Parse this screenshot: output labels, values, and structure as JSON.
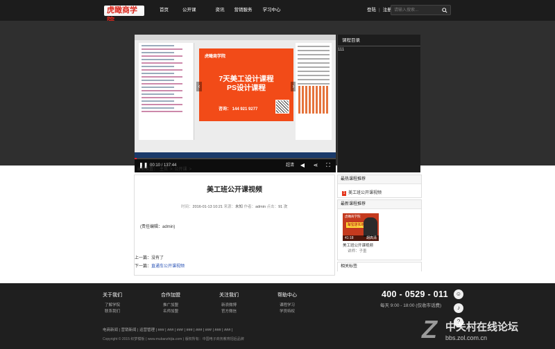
{
  "header": {
    "logo": "虎瞰商学院",
    "nav": [
      "首页",
      "公开课",
      "资讯",
      "营销服务",
      "学习中心"
    ],
    "login": "登陆",
    "register": "注册",
    "search_placeholder": "请输入搜索..."
  },
  "player": {
    "slide_logo": "虎瞰商学院",
    "slide_title1": "7天美工设计课程",
    "slide_title2": "PS设计课程",
    "slide_phone": "咨询：  144 921 9277",
    "time": "00:10 / 137:44",
    "quality": "超清",
    "progress": 0.01
  },
  "catalog": {
    "title": "课程目录",
    "item": "111"
  },
  "breadcrumb": {
    "label": "当前位置：",
    "home": "主页",
    "section": "公开课"
  },
  "article": {
    "title": "美工班公开课视频",
    "time_label": "时间：",
    "time": "2016-01-13 10:21",
    "source_label": "来源：",
    "source": "未知",
    "author_label": "作者：",
    "author": "admin",
    "clicks_label": "点击：",
    "clicks": "91 次",
    "editor": "(责任编辑：admin)",
    "prev": "上一篇：没有了",
    "next_label": "下一篇：",
    "next": "直通车公开课视频"
  },
  "sidebar": {
    "hot_title": "最热课程推荐",
    "hot_num": "1",
    "hot_item": "美工班公开课视频",
    "new_title": "最新课程推荐",
    "thumb_brand": "虎瞰商学院",
    "thumb_sign": "淘宝店长培训",
    "thumb_duration": "41:18",
    "thumb_name": "胡高清",
    "video_name": "美工班公开课视频",
    "lecturer": "讲师：子墨",
    "tags_title": "相关标签"
  },
  "footer": {
    "cols": [
      {
        "title": "关于我们",
        "links": [
          "了解学院",
          "联系我们"
        ]
      },
      {
        "title": "合作加盟",
        "links": [
          "推广加盟",
          "名师加盟"
        ]
      },
      {
        "title": "关注我们",
        "links": [
          "新浪微博",
          "官方微信"
        ]
      },
      {
        "title": "帮助中心",
        "links": [
          "课程学习",
          "学员特权"
        ]
      }
    ],
    "hotline": "400 - 0529 - 011",
    "hours": "每天 9:00 - 18:00 (仅收市话费)",
    "links": "电商新闻 | 营销新闻 | 运营管理 | ### | ### | ### | ### | ### | ### | ### | ### |",
    "copyright": "Copyright © 2015 织梦模板 ( www.mubanzhijia.com )    版权所有：中国电子商务教育招后品牌"
  },
  "watermark": {
    "mark": "Z",
    "name": "中关村在线论坛",
    "url": "bbs.zol.com.cn"
  }
}
